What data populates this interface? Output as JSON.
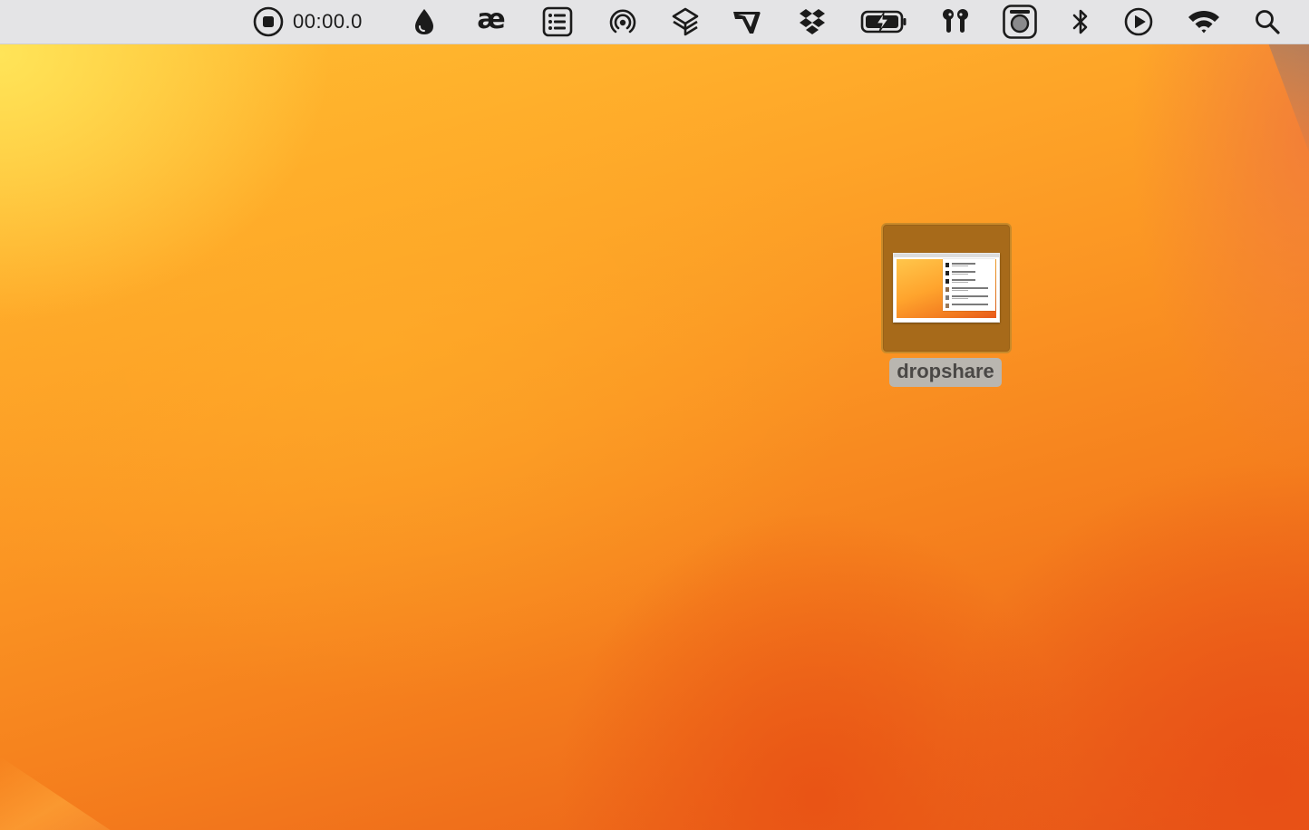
{
  "menubar": {
    "recorder": {
      "icon": "record-stop-icon",
      "time": "00:00.0"
    },
    "ae_glyph": "æ",
    "extras": [
      "drop-icon",
      "ae-icon",
      "list-icon",
      "airdrop-icon",
      "layers-icon",
      "folder-flag-icon",
      "dropbox-icon",
      "battery-charging-icon",
      "airpods-icon",
      "camera-icon",
      "bluetooth-icon",
      "play-icon",
      "wifi-icon",
      "search-icon"
    ]
  },
  "desktop": {
    "file": {
      "name": "dropshare",
      "icon": "screenshot-thumbnail"
    }
  },
  "colors": {
    "menubar_bg": "#e4e4e6",
    "wallpaper_top": "#ffc233",
    "wallpaper_bottom": "#e85a18",
    "icon_selection": "#a76a1a",
    "label_selection": "#b9b6b0"
  }
}
